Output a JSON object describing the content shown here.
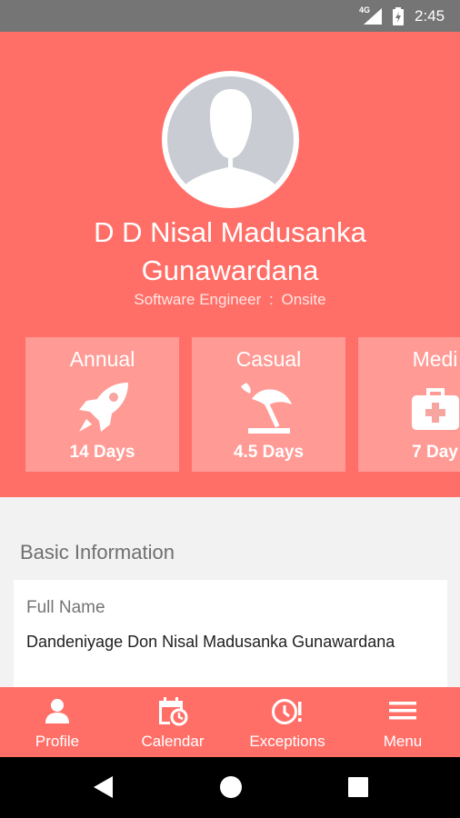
{
  "status_bar": {
    "network": "4G",
    "time": "2:45",
    "icons": [
      "signal-icon",
      "battery-charging-icon"
    ]
  },
  "profile": {
    "name_line1": "D D Nisal Madusanka",
    "name_line2": "Gunawardana",
    "designation": "Software Engineer",
    "separator": ":",
    "location": "Onsite",
    "avatar_icon": "person-silhouette-icon"
  },
  "leaves": [
    {
      "type": "Annual",
      "days": "14 Days",
      "icon": "rocket-icon"
    },
    {
      "type": "Casual",
      "days": "4.5 Days",
      "icon": "beach-umbrella-icon"
    },
    {
      "type": "Medi",
      "days": "7 Day",
      "icon": "medical-kit-icon"
    }
  ],
  "basic_info": {
    "section_title": "Basic Information",
    "fields": [
      {
        "label": "Full Name",
        "value": "Dandeniyage Don Nisal Madusanka Gunawardana"
      }
    ]
  },
  "bottom_nav": [
    {
      "label": "Profile",
      "icon": "person-icon"
    },
    {
      "label": "Calendar",
      "icon": "calendar-clock-icon"
    },
    {
      "label": "Exceptions",
      "icon": "clock-alert-icon"
    },
    {
      "label": "Menu",
      "icon": "hamburger-menu-icon"
    }
  ],
  "system_nav": [
    "back-icon",
    "home-icon",
    "recents-icon"
  ],
  "colors": {
    "primary": "#ff6f68",
    "status_bar": "#757575",
    "background": "#f2f2f2",
    "card": "#ffffff"
  }
}
